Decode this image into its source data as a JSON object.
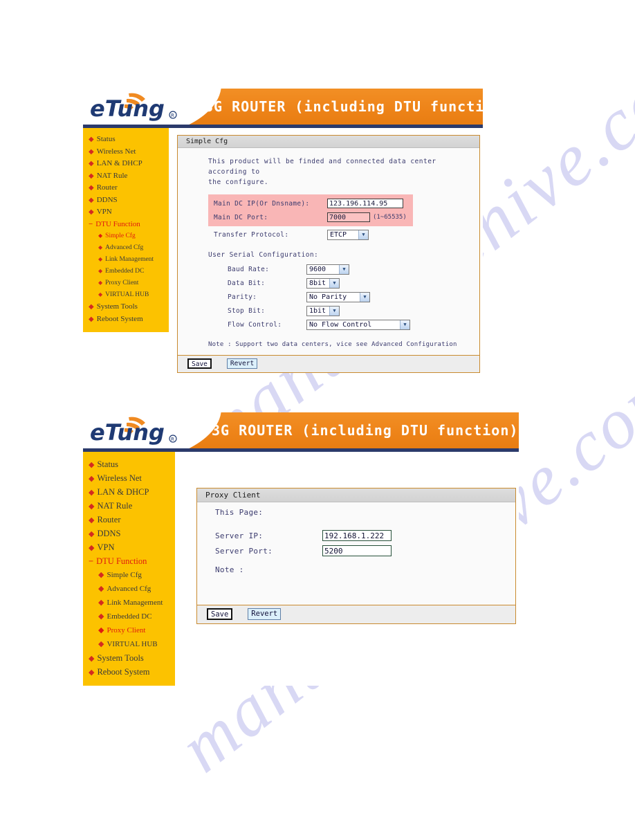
{
  "watermark": {
    "line1": "manualarchive.com",
    "line2": "manualarchive.com"
  },
  "banner": {
    "logo_text": "eTung",
    "logo_mark": "®",
    "title": "3G ROUTER (including DTU function)"
  },
  "sidebar": {
    "items": [
      {
        "label": "Status",
        "marker": "bullet",
        "level": 0,
        "active": false
      },
      {
        "label": "Wireless Net",
        "marker": "bullet",
        "level": 0,
        "active": false
      },
      {
        "label": "LAN & DHCP",
        "marker": "bullet",
        "level": 0,
        "active": false
      },
      {
        "label": "NAT Rule",
        "marker": "bullet",
        "level": 0,
        "active": false
      },
      {
        "label": "Router",
        "marker": "bullet",
        "level": 0,
        "active": false
      },
      {
        "label": "DDNS",
        "marker": "bullet",
        "level": 0,
        "active": false
      },
      {
        "label": "VPN",
        "marker": "bullet",
        "level": 0,
        "active": false
      },
      {
        "label": "DTU Function",
        "marker": "minus",
        "level": 0,
        "active": true
      },
      {
        "label": "Simple Cfg",
        "marker": "bullet",
        "level": 1,
        "active": false
      },
      {
        "label": "Advanced Cfg",
        "marker": "bullet",
        "level": 1,
        "active": false
      },
      {
        "label": "Link Management",
        "marker": "bullet",
        "level": 1,
        "active": false
      },
      {
        "label": "Embedded DC",
        "marker": "bullet",
        "level": 1,
        "active": false
      },
      {
        "label": "Proxy Client",
        "marker": "bullet",
        "level": 1,
        "active": false
      },
      {
        "label": "VIRTUAL HUB",
        "marker": "bullet",
        "level": 1,
        "active": false
      },
      {
        "label": "System Tools",
        "marker": "bullet",
        "level": 0,
        "active": false
      },
      {
        "label": "Reboot System",
        "marker": "bullet",
        "level": 0,
        "active": false
      }
    ],
    "active_index_shot1": 8,
    "active_index_shot2": 12
  },
  "shot1": {
    "panel_title": "Simple Cfg",
    "intro_line1": "This product will be finded and connected data center according to",
    "intro_line2": "the configure.",
    "fields": [
      {
        "label": "Main DC IP(Or Dnsname):",
        "value": "123.196.114.95",
        "hint": "",
        "highlight": true,
        "width": 110
      },
      {
        "label": "Main DC Port:",
        "value": "7000",
        "hint": "(1~65535)",
        "highlight": true,
        "width": 62
      }
    ],
    "transfer_protocol": {
      "label": "Transfer Protocol:",
      "value": "ETCP",
      "width": 44
    },
    "serial_section_title": "User Serial Configuration:",
    "serial_fields": [
      {
        "label": "Baud Rate:",
        "value": "9600",
        "width": 60
      },
      {
        "label": "Data Bit:",
        "value": "8bit",
        "width": 46
      },
      {
        "label": "Parity:",
        "value": "No Parity",
        "width": 92
      },
      {
        "label": "Stop Bit:",
        "value": "1bit",
        "width": 46
      },
      {
        "label": "Flow Control:",
        "value": "No Flow Control",
        "width": 150
      }
    ],
    "note": "Note : Support two data centers, vice see Advanced Configuration",
    "save_label": "Save",
    "revert_label": "Revert"
  },
  "shot2": {
    "panel_title": "Proxy Client",
    "this_page_label": "This Page:",
    "fields": [
      {
        "label": "Server IP:",
        "value": "192.168.1.222"
      },
      {
        "label": "Server Port:",
        "value": "5200"
      }
    ],
    "note_label": "Note :",
    "save_label": "Save",
    "revert_label": "Revert"
  },
  "colors": {
    "banner_orange": "#ee8419",
    "banner_underline": "#2b3a6b",
    "sidebar_yellow": "#fcc200",
    "active_red": "#e01b0f",
    "highlight_pink": "#f9b6b6",
    "panel_border": "#c98a2e",
    "text_blue": "#3b3b6e"
  }
}
